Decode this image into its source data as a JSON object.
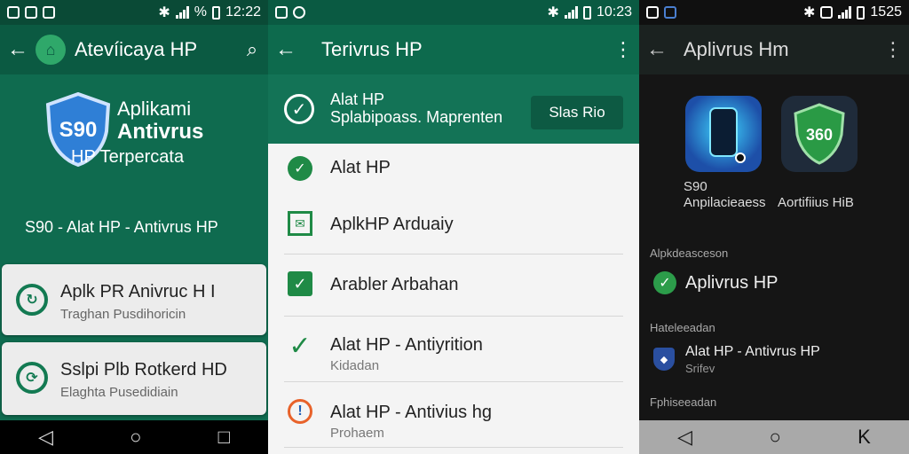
{
  "panel1": {
    "status": {
      "left_icons": [
        "notification-icon",
        "sd-card-icon",
        "image-icon"
      ],
      "time": "12:22",
      "battery_text": "%"
    },
    "appbar": {
      "title": "Atevíicaya HP",
      "search_icon": "search-icon"
    },
    "hero": {
      "shield_text": "S90",
      "title_line1": "Aplikami",
      "title_line2": "Antivrus",
      "subtitle": "HP Terpercata",
      "line": "S90  -  Alat HP - Antivrus HP"
    },
    "cards": [
      {
        "title": "Aplk PR Anivruc H I",
        "subtitle": "Traghan Pusdihoricin"
      },
      {
        "title": "Sslpi Plb Rotkerd HD",
        "subtitle": "Elaghta Pusedidiain"
      }
    ],
    "brand_color": "#0f6b4f"
  },
  "panel2": {
    "status": {
      "time": "10:23"
    },
    "appbar": {
      "title": "Terivrus HP"
    },
    "header": {
      "line1": "Alat HP",
      "line2": "Splabipoass.  Maprenten",
      "button": "Slas Rio"
    },
    "items": [
      {
        "title": "Alat HP",
        "subtitle": "",
        "icon": "check-circle-icon"
      },
      {
        "title": "AplkHP Arduaiy",
        "subtitle": "",
        "icon": "mail-icon"
      },
      {
        "title": "Arabler Arbahan",
        "subtitle": "",
        "icon": "checkbox-icon"
      },
      {
        "title": "Alat HP - Antiyrition",
        "subtitle": "Kidadan",
        "icon": "check-icon"
      },
      {
        "title": "Alat HP - Antivius hg",
        "subtitle": "Prohaem",
        "icon": "clock-icon"
      }
    ]
  },
  "panel3": {
    "status": {
      "time": "1525"
    },
    "appbar": {
      "title": "Aplivrus Hm"
    },
    "tiles": [
      {
        "label_line1": "S90",
        "label_line2": "Anpilacieaess",
        "icon": "phone-icon"
      },
      {
        "label_line1": "",
        "label_line2": "Aortifiius HiB",
        "icon": "shield-icon",
        "badge": "360"
      }
    ],
    "sections": [
      {
        "header": "Alpkdeasceson",
        "item": "Aplivrus HP",
        "item_sub": ""
      },
      {
        "header": "Hateleeadan",
        "item": "Alat HP - Antivrus HP",
        "item_sub": "Srifev"
      },
      {
        "header": "Fphiseeadan",
        "item": "",
        "item_sub": ""
      }
    ]
  },
  "nav": {
    "back": "◁",
    "home": "○",
    "recents": "□",
    "alt_back": "K"
  }
}
